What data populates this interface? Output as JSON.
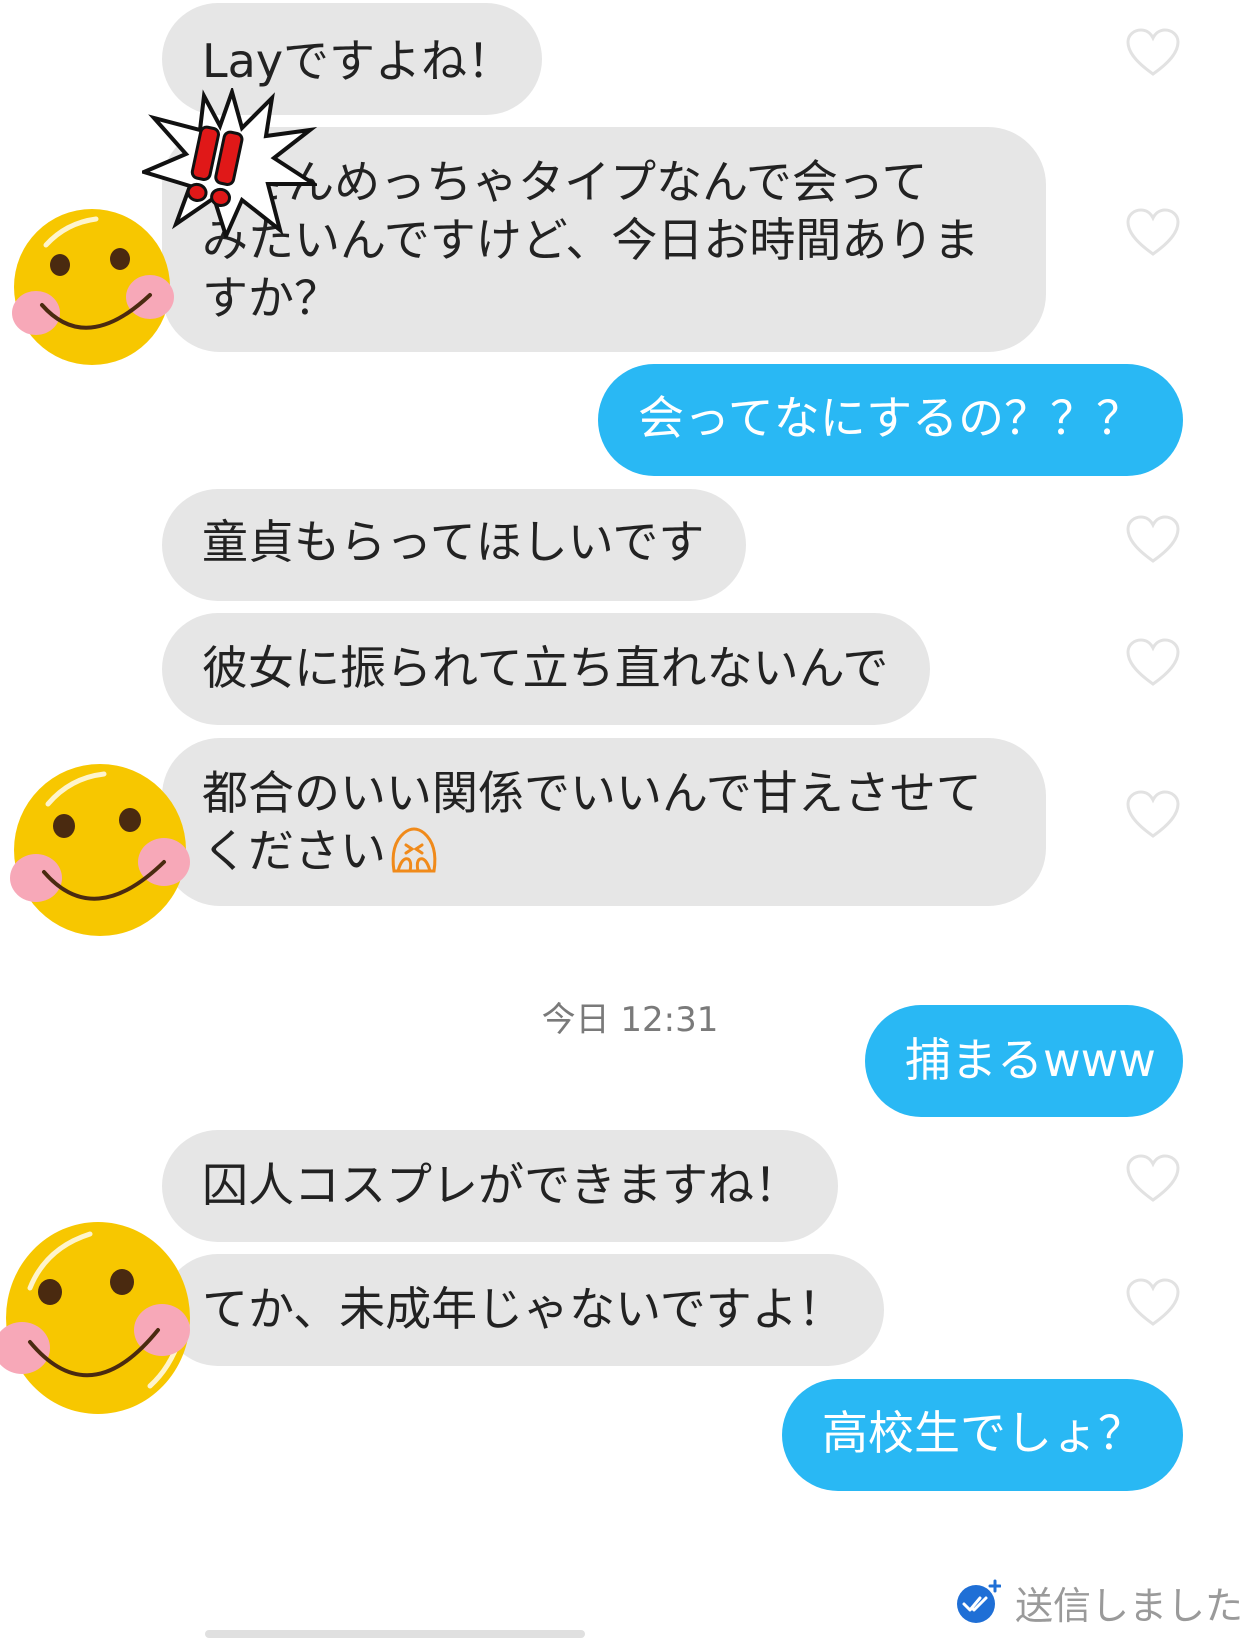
{
  "theme": {
    "incoming_bubble_color": "#e6e6e6",
    "outgoing_bubble_color": "#29b8f4",
    "avatar_face_color": "#f7c700",
    "sent_check_color": "#1f6fd6"
  },
  "messages": {
    "m1": {
      "text": "Layですよね！"
    },
    "m2": {
      "lines": [
        "○さんめっちゃタイプなんで会って",
        "みたいんですけど、今日お時間ありま",
        "すか？"
      ]
    },
    "m3": {
      "text": "会ってなにするの？？？"
    },
    "m4": {
      "text": "童貞もらってほしいです"
    },
    "m5": {
      "text": "彼女に振られて立ち直れないんで"
    },
    "m6": {
      "lines": [
        "都合のいい関係でいいんで甘えさせて",
        "ください"
      ],
      "emoji": "covering-face-emoji"
    },
    "m7": {
      "text": "捕まるwww"
    },
    "m8": {
      "text": "囚人コスプレができますね！"
    },
    "m9": {
      "text": "てか、未成年じゃないですよ！"
    },
    "m10": {
      "text": "高校生でしょ？"
    }
  },
  "timestamp": {
    "day": "今日",
    "time": "12:31"
  },
  "status": {
    "sent_label": "送信しました",
    "icon": "double-check-icon"
  },
  "icons": {
    "like": "heart-outline-icon",
    "sticker": "exclamation-burst-sticker",
    "avatar": "smiley-face-sticker"
  }
}
